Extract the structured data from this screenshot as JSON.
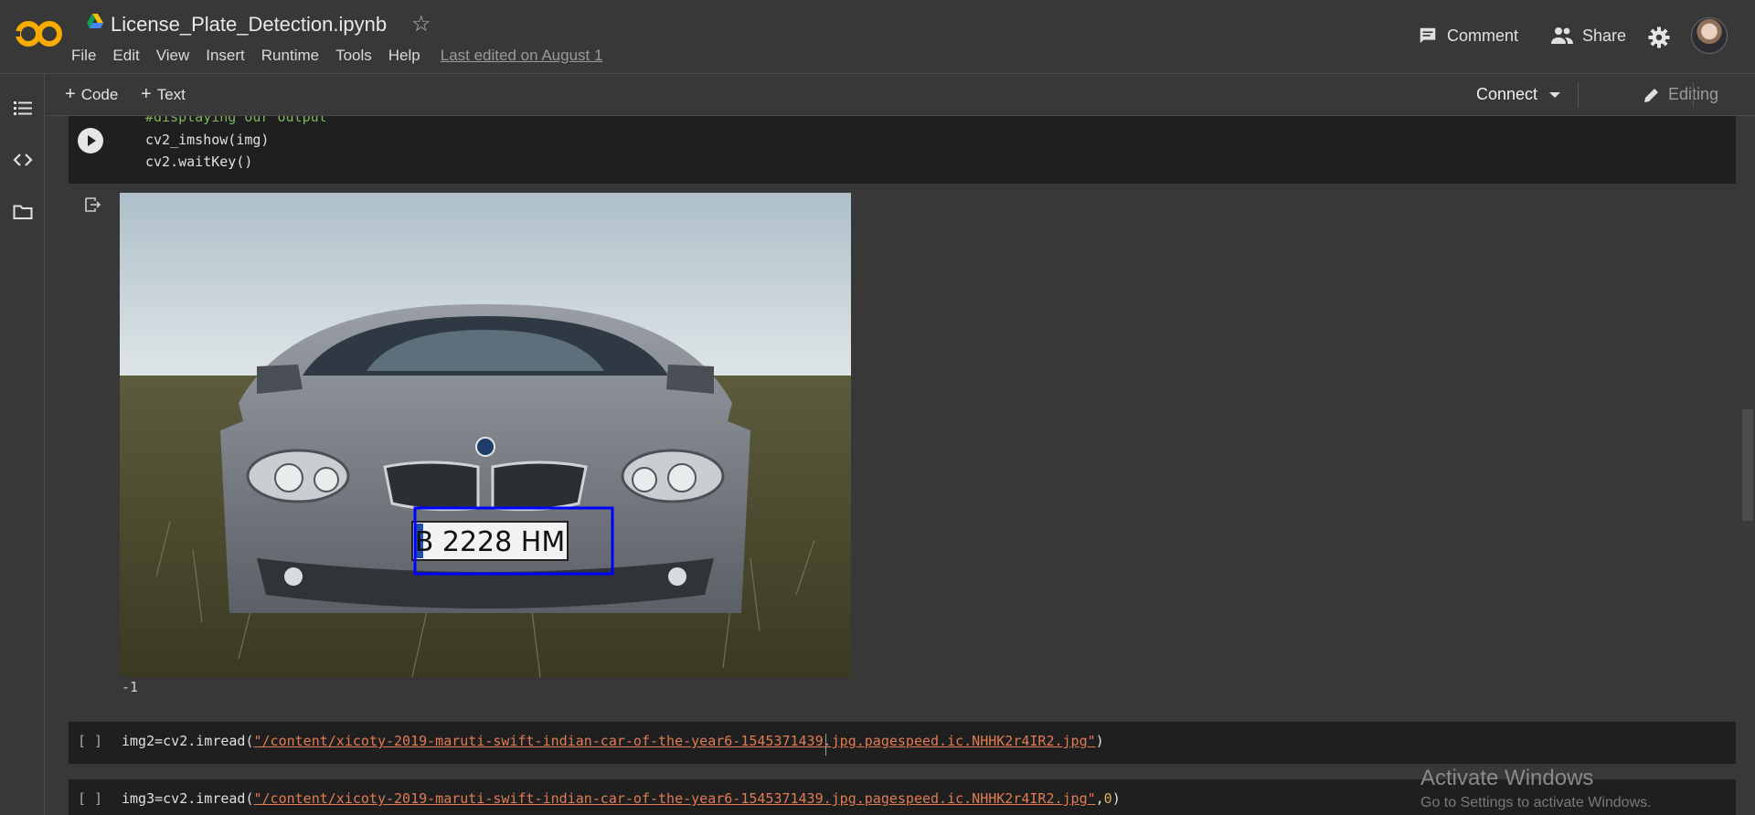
{
  "header": {
    "title": "License_Plate_Detection.ipynb",
    "menu": [
      "File",
      "Edit",
      "View",
      "Insert",
      "Runtime",
      "Tools",
      "Help"
    ],
    "last_edited": "Last edited on August 1",
    "comment_label": "Comment",
    "share_label": "Share",
    "brand_color": "#f9ab00"
  },
  "sidebar": {
    "icons": [
      "table-of-contents-icon",
      "code-snippets-icon",
      "files-folder-icon"
    ]
  },
  "toolbar": {
    "add_code_label": "Code",
    "add_text_label": "Text",
    "connect_label": "Connect",
    "editing_label": "Editing"
  },
  "cells": {
    "cell1": {
      "lines": [
        "#displaying our output",
        "cv2_imshow(img)",
        "cv2.waitKey()"
      ]
    },
    "output": {
      "image_description": "Gray BMW sedan with license plate B 2228 HM outlined by a blue detection box",
      "plate_text": "B 2228 HM",
      "box_color": "#0000ff",
      "result_text": "-1"
    },
    "cell2": {
      "prompt": "[ ]",
      "prefix": "img2=cv2.imread(",
      "path": "\"/content/xicoty-2019-maruti-swift-indian-car-of-the-year6-1545371439.jpg.pagespeed.ic.NHHK2r4IR2.jpg\"",
      "suffix": ")"
    },
    "cell3": {
      "prompt": "[ ]",
      "prefix": "img3=cv2.imread(",
      "path": "\"/content/xicoty-2019-maruti-swift-indian-car-of-the-year6-1545371439.jpg.pagespeed.ic.NHHK2r4IR2.jpg\"",
      "arg_sep": ",",
      "arg": "0",
      "suffix": ")"
    }
  },
  "watermark": {
    "line1": "Activate Windows",
    "line2": "Go to Settings to activate Windows."
  }
}
